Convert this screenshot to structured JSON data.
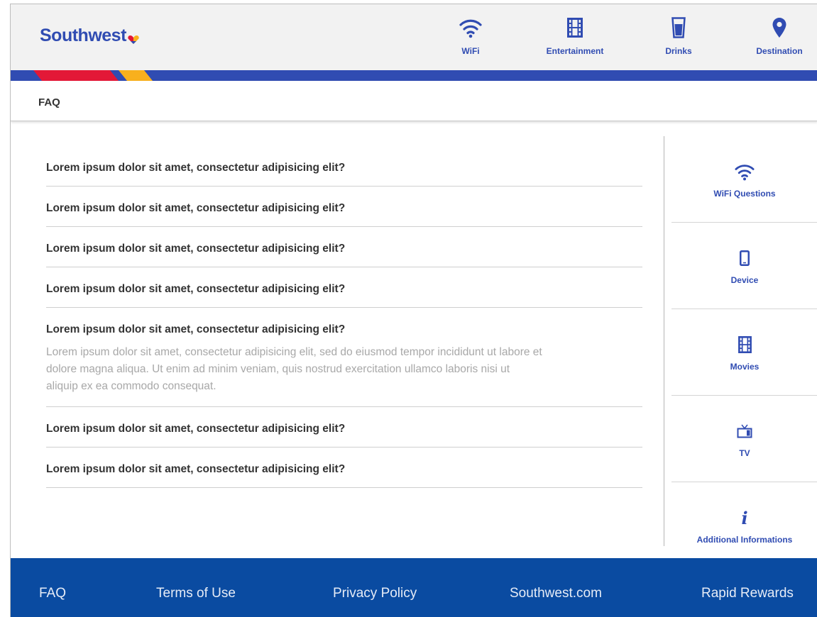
{
  "brand": {
    "name": "Southwest",
    "primary": "#304cb2",
    "red": "#e31837",
    "yellow": "#f8b01d",
    "footer_blue": "#0a4ba1"
  },
  "nav": {
    "items": [
      {
        "label": "WiFi",
        "icon": "wifi-icon"
      },
      {
        "label": "Entertainment",
        "icon": "film-icon"
      },
      {
        "label": "Drinks",
        "icon": "cup-icon"
      },
      {
        "label": "Destination",
        "icon": "map-pin-icon"
      }
    ]
  },
  "breadcrumb": {
    "title": "FAQ"
  },
  "faq": {
    "items": [
      {
        "question": "Lorem ipsum dolor sit amet, consectetur adipisicing elit?"
      },
      {
        "question": "Lorem ipsum dolor sit amet, consectetur adipisicing elit?"
      },
      {
        "question": "Lorem ipsum dolor sit amet, consectetur adipisicing elit?"
      },
      {
        "question": "Lorem ipsum dolor sit amet, consectetur adipisicing elit?"
      },
      {
        "question": "Lorem ipsum dolor sit amet, consectetur adipisicing elit?",
        "answer": "Lorem ipsum dolor sit amet, consectetur adipisicing elit, sed do eiusmod tempor incididunt ut labore et dolore magna aliqua. Ut enim ad minim veniam, quis nostrud exercitation ullamco laboris nisi ut aliquip ex ea commodo consequat.",
        "expanded": true
      },
      {
        "question": "Lorem ipsum dolor sit amet, consectetur adipisicing elit?"
      },
      {
        "question": "Lorem ipsum dolor sit amet, consectetur adipisicing elit?"
      }
    ]
  },
  "side": {
    "items": [
      {
        "label": "WiFi Questions",
        "icon": "wifi-icon"
      },
      {
        "label": "Device",
        "icon": "phone-icon"
      },
      {
        "label": "Movies",
        "icon": "film-icon"
      },
      {
        "label": "TV",
        "icon": "tv-icon"
      },
      {
        "label": "Additional Informations",
        "icon": "info-icon"
      }
    ]
  },
  "footer": {
    "links": [
      "FAQ",
      "Terms of Use",
      "Privacy Policy",
      "Southwest.com",
      "Rapid Rewards"
    ]
  }
}
